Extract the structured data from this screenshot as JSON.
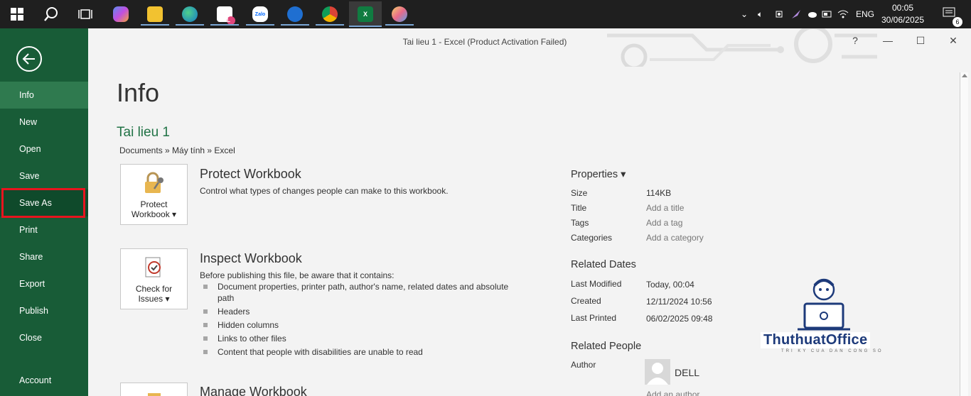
{
  "taskbar": {
    "tray_lang": "ENG",
    "clock_time": "00:05",
    "clock_date": "30/06/2025",
    "notification_count": "6",
    "apps": [
      {
        "name": "copilot"
      },
      {
        "name": "file-explorer"
      },
      {
        "name": "edge"
      },
      {
        "name": "app-l",
        "label": "L"
      },
      {
        "name": "zalo",
        "label": "Zalo"
      },
      {
        "name": "remote-desktop"
      },
      {
        "name": "chrome"
      },
      {
        "name": "excel",
        "label": "X"
      },
      {
        "name": "paint"
      }
    ]
  },
  "window": {
    "title": "Tai lieu 1 - Excel (Product Activation Failed)",
    "help": "?",
    "minimize": "—",
    "maximize": "☐",
    "close": "✕"
  },
  "sidebar": {
    "items": [
      {
        "label": "Info"
      },
      {
        "label": "New"
      },
      {
        "label": "Open"
      },
      {
        "label": "Save"
      },
      {
        "label": "Save As"
      },
      {
        "label": "Print"
      },
      {
        "label": "Share"
      },
      {
        "label": "Export"
      },
      {
        "label": "Publish"
      },
      {
        "label": "Close"
      },
      {
        "label": "Account"
      }
    ]
  },
  "info": {
    "page_title": "Info",
    "doc_name": "Tai lieu 1",
    "doc_path": "Documents » Máy tính » Excel",
    "protect": {
      "button_line1": "Protect",
      "button_line2": "Workbook ▾",
      "title": "Protect Workbook",
      "desc": "Control what types of changes people can make to this workbook."
    },
    "inspect": {
      "button_line1": "Check for",
      "button_line2": "Issues ▾",
      "title": "Inspect Workbook",
      "desc": "Before publishing this file, be aware that it contains:",
      "bullets": [
        "Document properties, printer path, author's name, related dates and absolute path",
        "Headers",
        "Hidden columns",
        "Links to other files",
        "Content that people with disabilities are unable to read"
      ]
    },
    "manage": {
      "title": "Manage Workbook"
    }
  },
  "properties": {
    "heading": "Properties ▾",
    "size_label": "Size",
    "size_value": "114KB",
    "title_label": "Title",
    "title_value": "Add a title",
    "tags_label": "Tags",
    "tags_value": "Add a tag",
    "categories_label": "Categories",
    "categories_value": "Add a category",
    "dates_heading": "Related Dates",
    "modified_label": "Last Modified",
    "modified_value": "Today, 00:04",
    "created_label": "Created",
    "created_value": "12/11/2024 10:56",
    "printed_label": "Last Printed",
    "printed_value": "06/02/2025 09:48",
    "people_heading": "Related People",
    "author_label": "Author",
    "author_value": "DELL",
    "add_author": "Add an author"
  },
  "watermark": {
    "brand": "ThuthuatOffice",
    "tagline": "TRI KY CUA DAN CONG SO"
  }
}
